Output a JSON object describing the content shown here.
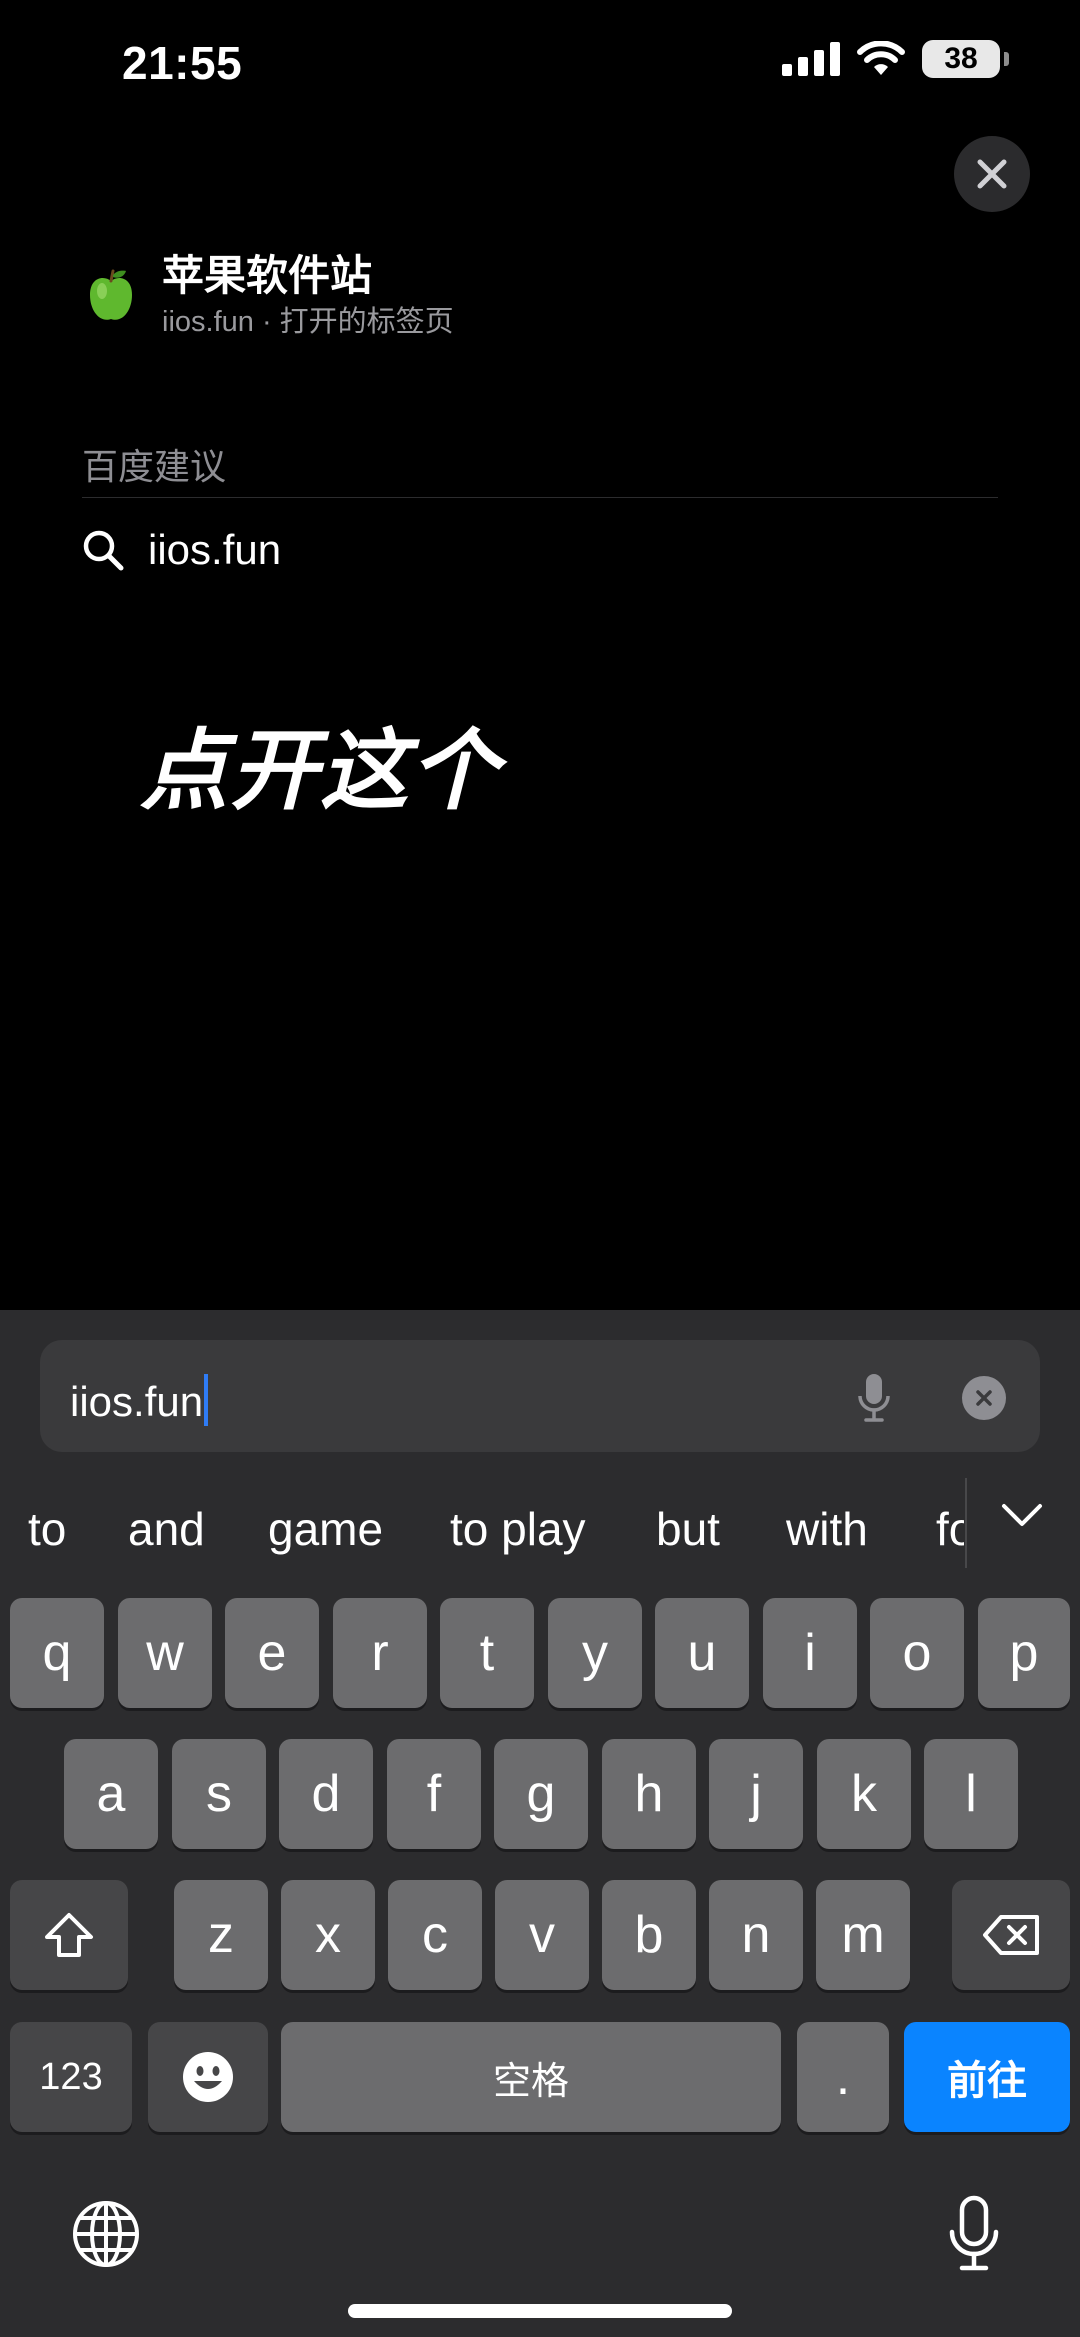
{
  "status_bar": {
    "time": "21:55",
    "battery": "38"
  },
  "tab_suggestion": {
    "title": "苹果软件站",
    "subtitle": "iios.fun · 打开的标签页"
  },
  "section": {
    "title": "百度建议"
  },
  "suggestion": {
    "query": "iios.fun"
  },
  "annotation": "点开这个",
  "address_bar": {
    "value": "iios.fun"
  },
  "predictions": [
    "to",
    "and",
    "game",
    "to play",
    "but",
    "with",
    "fo"
  ],
  "keyboard": {
    "row1": [
      "q",
      "w",
      "e",
      "r",
      "t",
      "y",
      "u",
      "i",
      "o",
      "p"
    ],
    "row2": [
      "a",
      "s",
      "d",
      "f",
      "g",
      "h",
      "j",
      "k",
      "l"
    ],
    "row3": [
      "z",
      "x",
      "c",
      "v",
      "b",
      "n",
      "m"
    ],
    "numbers_label": "123",
    "space_label": "空格",
    "period_label": ".",
    "go_label": "前往"
  },
  "colors": {
    "accent": "#0a84ff",
    "key": "#6c6c6e",
    "panel": "#2c2c2e"
  }
}
